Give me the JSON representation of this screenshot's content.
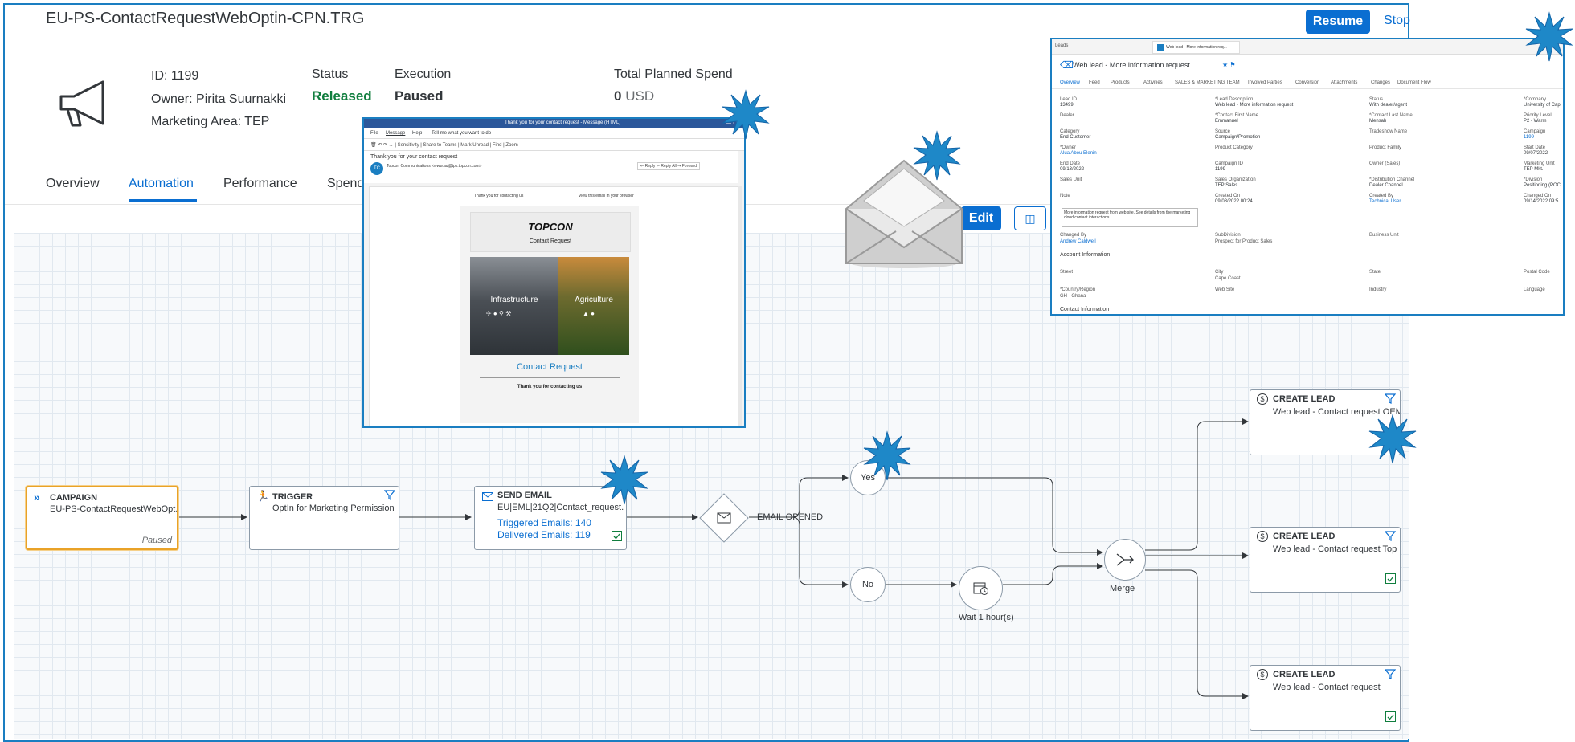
{
  "header": {
    "title": "EU-PS-ContactRequestWebOptin-CPN.TRG",
    "resume_label": "Resume",
    "stop_label": "Stop",
    "id_text": "ID: 1199",
    "owner_text": "Owner: Pirita Suurnakki",
    "area_text": "Marketing Area: TEP",
    "status_label": "Status",
    "status_value": "Released",
    "execution_label": "Execution",
    "execution_value": "Paused",
    "spend_label": "Total Planned Spend",
    "spend_value": "0",
    "spend_unit": "USD",
    "status_color": "#107e3e"
  },
  "tabs": [
    {
      "label": "Overview"
    },
    {
      "label": "Automation"
    },
    {
      "label": "Performance"
    },
    {
      "label": "Spend"
    }
  ],
  "toolbar": {
    "edit_label": "Edit"
  },
  "flow": {
    "campaign": {
      "title": "CAMPAIGN",
      "text": "EU-PS-ContactRequestWebOpt...",
      "status": "Paused"
    },
    "trigger": {
      "title": "TRIGGER",
      "text": "OptIn for Marketing Permission"
    },
    "email": {
      "title": "SEND EMAIL",
      "text": "EU|EML|21Q2|Contact_request...",
      "triggered": "Triggered Emails: 140",
      "delivered": "Delivered Emails: 119"
    },
    "decision_label": "EMAIL OPENED",
    "yes": "Yes",
    "no": "No",
    "wait_label": "Wait 1 hour(s)",
    "merge_label": "Merge",
    "lead1": {
      "title": "CREATE LEAD",
      "text": "Web lead - Contact request OEM"
    },
    "lead2": {
      "title": "CREATE LEAD",
      "text": "Web lead - Contact request Top..."
    },
    "lead3": {
      "title": "CREATE LEAD",
      "text": "Web lead - Contact request"
    }
  },
  "email_window": {
    "titlebar": "Thank you for your contact request - Message (HTML)",
    "menu": [
      "File",
      "Message",
      "Help"
    ],
    "tell_me": "Tell me what you want to do",
    "subject": "Thank you for your contact request",
    "sender": "Topcon Communications <www.au@tpk.topcon.com>",
    "thanks_small": "Thank you for contacting us",
    "view_browser": "View this email in your browser",
    "logo": "TOPCON",
    "contact_request_header": "Contact Request",
    "img_left": "Infrastructure",
    "img_right": "Agriculture",
    "contact_request": "Contact Request",
    "thanks": "Thank you for contacting us"
  },
  "lead_window": {
    "tab_leads": "Leads",
    "tab_lead": "Web lead - More information req...",
    "title": "Web lead - More information request",
    "tabs": [
      "Overview",
      "Feed",
      "Products",
      "Activities",
      "SALES & MARKETING TEAM",
      "Involved Parties",
      "Conversion",
      "Attachments",
      "Changes",
      "Document Flow"
    ],
    "fields": [
      {
        "label": "Lead ID",
        "value": "13499"
      },
      {
        "label": "*Lead Description",
        "value": "Web lead - More information request"
      },
      {
        "label": "Status",
        "value": "With dealer/agent"
      },
      {
        "label": "*Company",
        "value": "University of Cap"
      },
      {
        "label": "Dealer",
        "value": ""
      },
      {
        "label": "*Contact First Name",
        "value": "Emmanuel"
      },
      {
        "label": "*Contact Last Name",
        "value": "Mensah"
      },
      {
        "label": "Priority Level",
        "value": "P2 - Warm"
      },
      {
        "label": "Category",
        "value": "End Customer"
      },
      {
        "label": "Source",
        "value": "Campaign/Promotion"
      },
      {
        "label": "Tradeshow Name",
        "value": ""
      },
      {
        "label": "Campaign",
        "value": "1199"
      },
      {
        "label": "*Owner",
        "value": "Alua Abou Elenin"
      },
      {
        "label": "Product Category",
        "value": ""
      },
      {
        "label": "Product Family",
        "value": ""
      },
      {
        "label": "Start Date",
        "value": "09/07/2022"
      },
      {
        "label": "End Date",
        "value": "09/13/2022"
      },
      {
        "label": "Campaign ID",
        "value": "1199"
      },
      {
        "label": "Owner (Sales)",
        "value": ""
      },
      {
        "label": "Marketing Unit",
        "value": "TEP Mkt."
      },
      {
        "label": "Sales Unit",
        "value": ""
      },
      {
        "label": "Sales Organization",
        "value": "TEP Sales"
      },
      {
        "label": "*Distribution Channel",
        "value": "Dealer Channel"
      },
      {
        "label": "*Division",
        "value": "Positioning (POC"
      },
      {
        "label": "Note",
        "value": ""
      },
      {
        "label": "Created On",
        "value": "09/08/2022 00:24"
      },
      {
        "label": "Created By",
        "value": "Technical User"
      },
      {
        "label": "Changed On",
        "value": "09/14/2022 09:5"
      }
    ],
    "note_text": "More information request from web site. See details from the marketing cloud contact interactions.",
    "changed_by_label": "Changed By",
    "changed_by": "Andrew Caldwell",
    "subdivision_label": "SubDivision",
    "subdivision": "Prospect for Product Sales",
    "business_unit_label": "Business Unit",
    "account_info": "Account Information",
    "street_label": "Street",
    "city_label": "City",
    "city": "Cape Coast",
    "state_label": "State",
    "postal_label": "Postal Code",
    "country_label": "*Country/Region",
    "country": "GH - Ghana",
    "website_label": "Web Site",
    "industry_label": "Industry",
    "language_label": "Language",
    "contact_info": "Contact Information"
  },
  "colors": {
    "accent": "#0a6ed1",
    "starburst": "#1e88c8",
    "node_border": "#8c9aa8"
  }
}
